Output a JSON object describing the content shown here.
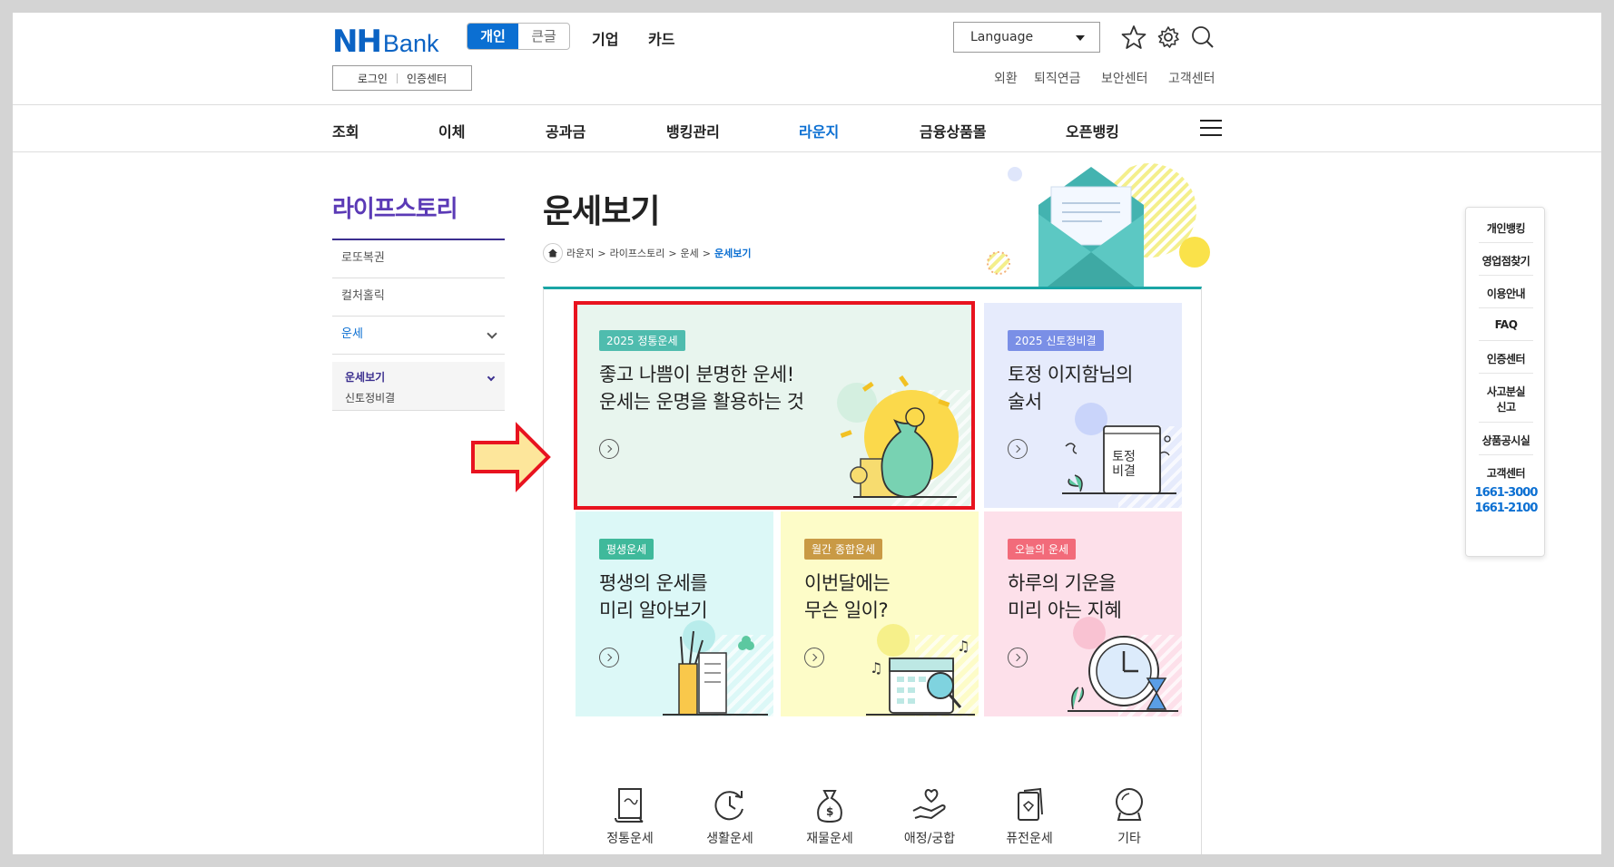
{
  "header": {
    "logo_nh": "NH",
    "logo_bank": "Bank",
    "mode_personal": "개인",
    "mode_large": "큰글",
    "nav_corp": "기업",
    "nav_card": "카드",
    "language": "Language",
    "login": "로그인",
    "cert": "인증센터",
    "util": [
      "외환",
      "퇴직연금",
      "보안센터",
      "고객센터"
    ]
  },
  "gnb": [
    "조회",
    "이체",
    "공과금",
    "뱅킹관리",
    "라운지",
    "금융상품몰",
    "오픈뱅킹"
  ],
  "lnb": {
    "title": "라이프스토리",
    "items": [
      "로또복권",
      "컬처홀릭",
      "운세"
    ],
    "sub_active": "운세보기",
    "sub_item": "신토정비결"
  },
  "page": {
    "title": "운세보기",
    "breadcrumb": [
      "라운지",
      "라이프스토리",
      "운세",
      "운세보기"
    ]
  },
  "cards": [
    {
      "tag": "2025 정통운세",
      "line1": "좋고 나쁨이 분명한 운세!",
      "line2": "운세는 운명을 활용하는 것",
      "tag_color": "#4fbcae",
      "bg": "#e8f5ee"
    },
    {
      "tag": "2025 신토정비결",
      "line1": "토정 이지함님의",
      "line2": "술서",
      "tag_color": "#7a8fe6",
      "bg": "#e6ebfc",
      "book_text": "토정 비결"
    },
    {
      "tag": "평생운세",
      "line1": "평생의 운세를",
      "line2": "미리 알아보기",
      "tag_color": "#3fb99b",
      "bg": "#dcf8f7"
    },
    {
      "tag": "월간 종합운세",
      "line1": "이번달에는",
      "line2": "무슨 일이?",
      "tag_color": "#c99a45",
      "bg": "#fdfcc8"
    },
    {
      "tag": "오늘의 운세",
      "line1": "하루의 기운을",
      "line2": "미리 아는 지혜",
      "tag_color": "#f26b7a",
      "bg": "#fde0ea"
    }
  ],
  "categories": [
    "정통운세",
    "생활운세",
    "재물운세",
    "애정/궁합",
    "퓨전운세",
    "기타"
  ],
  "quick_menu": [
    "개인뱅킹",
    "영업점찾기",
    "이용안내",
    "FAQ",
    "인증센터",
    "사고분실",
    "신고",
    "상품공시실",
    "고객센터"
  ],
  "phones": [
    "1661-3000",
    "1661-2100"
  ]
}
